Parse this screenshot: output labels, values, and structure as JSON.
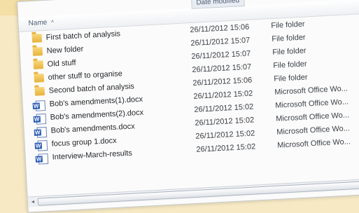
{
  "header": {
    "name_label": "Name",
    "date_label": "Date modified",
    "sort_glyph": "^"
  },
  "rows": [
    {
      "name": "First batch of analysis",
      "date": "26/11/2012 15:06",
      "type": "File folder",
      "icon": "folder-icon"
    },
    {
      "name": "New folder",
      "date": "26/11/2012 15:07",
      "type": "File folder",
      "icon": "folder-icon"
    },
    {
      "name": "Old stuff",
      "date": "26/11/2012 15:07",
      "type": "File folder",
      "icon": "folder-icon"
    },
    {
      "name": "other stuff to organise",
      "date": "26/11/2012 15:07",
      "type": "File folder",
      "icon": "folder-icon"
    },
    {
      "name": "Second batch of analysis",
      "date": "26/11/2012 15:06",
      "type": "File folder",
      "icon": "folder-icon"
    },
    {
      "name": "Bob's amendments(1).docx",
      "date": "26/11/2012 15:02",
      "type": "Microsoft Office Wo...",
      "icon": "word-document-icon"
    },
    {
      "name": "Bob's amendments(2).docx",
      "date": "26/11/2012 15:02",
      "type": "Microsoft Office Wo...",
      "icon": "word-document-icon"
    },
    {
      "name": "Bob's amendments.docx",
      "date": "26/11/2012 15:02",
      "type": "Microsoft Office Wo...",
      "icon": "word-document-icon"
    },
    {
      "name": "focus group 1.docx",
      "date": "26/11/2012 15:02",
      "type": "Microsoft Office Wo...",
      "icon": "word-document-icon"
    },
    {
      "name": "Interview-March-results",
      "date": "26/11/2012 15:02",
      "type": "Microsoft Office Wo...",
      "icon": "word-document-icon"
    }
  ],
  "scrollbar": {
    "left_arrow": "◂",
    "right_arrow": "▸"
  }
}
